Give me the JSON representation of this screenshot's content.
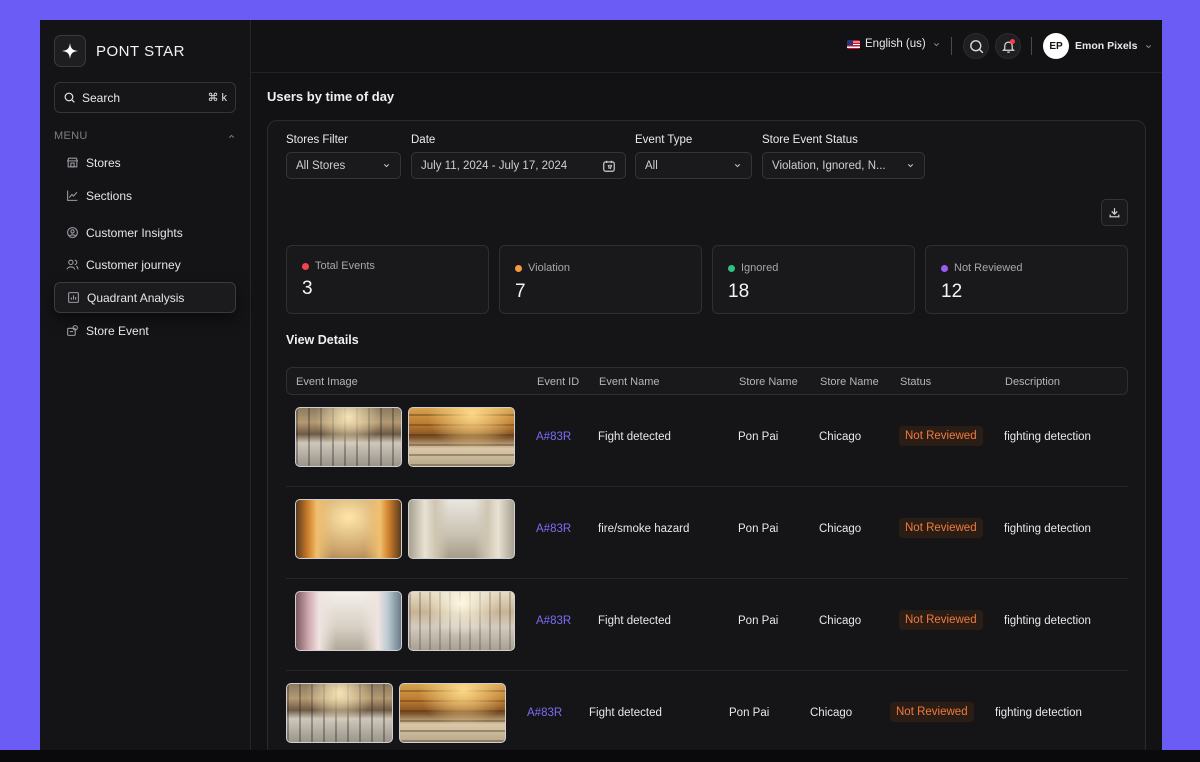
{
  "brand": {
    "name": "PONT STAR"
  },
  "sidebar": {
    "search_label": "Search",
    "search_shortcut": "⌘ k",
    "menu_label": "MENU",
    "items": [
      {
        "label": "Stores",
        "icon": "store-icon"
      },
      {
        "label": "Sections",
        "icon": "chart-line-icon"
      },
      {
        "label": "Customer Insights",
        "icon": "user-circle-icon"
      },
      {
        "label": "Customer journey",
        "icon": "users-icon"
      },
      {
        "label": "Quadrant Analysis",
        "icon": "bar-chart-icon",
        "active": true
      },
      {
        "label": "Store Event",
        "icon": "event-icon"
      }
    ]
  },
  "topbar": {
    "language": "English (us)",
    "user_initials": "EP",
    "user_name": "Emon Pixels"
  },
  "page": {
    "title": "Users by time of day"
  },
  "filters": {
    "stores": {
      "label": "Stores Filter",
      "value": "All Stores"
    },
    "date": {
      "label": "Date",
      "value": "July 11, 2024 - July 17, 2024"
    },
    "event_type": {
      "label": "Event Type",
      "value": "All"
    },
    "status": {
      "label": "Store Event Status",
      "value": "Violation, Ignored, N..."
    }
  },
  "stats": [
    {
      "label": "Total Events",
      "value": "3",
      "color": "#f0444e"
    },
    {
      "label": "Violation",
      "value": "7",
      "color": "#f49a3c"
    },
    {
      "label": "Ignored",
      "value": "18",
      "color": "#2ec27e"
    },
    {
      "label": "Not Reviewed",
      "value": "12",
      "color": "#9b5cf6"
    }
  ],
  "details": {
    "title": "View Details",
    "columns": [
      "Event Image",
      "Event ID",
      "Event Name",
      "Store Name",
      "Store Name",
      "Status",
      "Description"
    ],
    "rows": [
      {
        "id": "A#83R",
        "name": "Fight detected",
        "store": "Pon Pai",
        "city": "Chicago",
        "status": "Not Reviewed",
        "description": "fighting detection"
      },
      {
        "id": "A#83R",
        "name": "fire/smoke hazard",
        "store": "Pon Pai",
        "city": "Chicago",
        "status": "Not Reviewed",
        "description": "fighting detection"
      },
      {
        "id": "A#83R",
        "name": "Fight detected",
        "store": "Pon Pai",
        "city": "Chicago",
        "status": "Not Reviewed",
        "description": "fighting detection"
      },
      {
        "id": "A#83R",
        "name": "Fight detected",
        "store": "Pon Pai",
        "city": "Chicago",
        "status": "Not Reviewed",
        "description": "fighting detection"
      }
    ]
  },
  "colors": {
    "accent": "#7b6cf6",
    "frame": "#6b5cf6",
    "status_not_reviewed": "#f07a3e"
  }
}
